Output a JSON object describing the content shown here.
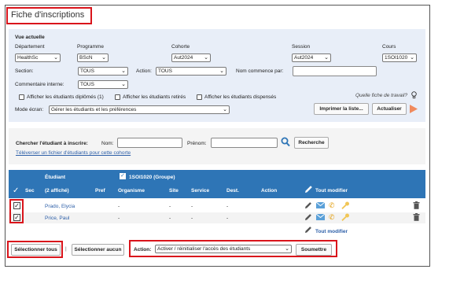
{
  "page_title": "Fiche d'inscriptions",
  "vue": {
    "heading": "Vue actuelle",
    "departement_label": "Département",
    "departement_value": "HealthSc",
    "programme_label": "Programme",
    "programme_value": "BScN",
    "cohorte_label": "Cohorte",
    "cohorte_value": "Aut2024",
    "session_label": "Session",
    "session_value": "Aut2024",
    "cours_label": "Cours",
    "cours_value": "1SOI1020",
    "section_label": "Section:",
    "section_value": "TOUS",
    "action_label": "Action:",
    "action_value": "TOUS",
    "nom_commence_label": "Nom commence par:",
    "commentaire_label": "Commentaire interne:",
    "commentaire_value": "TOUS",
    "cb_diplomes": "Afficher les étudiants diplômés (1)",
    "cb_retires": "Afficher les étudiants retirés",
    "cb_dispenses": "Afficher les étudiants dispensés",
    "quelle_fiche": "Quelle fiche de travail?",
    "mode_label": "Mode écran:",
    "mode_value": "Gérer les étudiants et les préférences",
    "imprimer_label": "Imprimer la liste...",
    "actualiser_label": "Actualiser"
  },
  "search": {
    "heading": "Chercher l'étudiant à inscrire:",
    "nom_label": "Nom:",
    "prenom_label": "Prénom:",
    "recherche_label": "Recherche",
    "upload_link": "Téléverser un fichier d'étudiants pour cette cohorte"
  },
  "table": {
    "etudiant_header": "Étudiant",
    "course_header": "1SOI1020",
    "course_group": "(Groupe)",
    "sec_header": "Sec",
    "count_header": "(2 affiché)",
    "pref_header": "Pref",
    "organisme_header": "Organisme",
    "site_header": "Site",
    "service_header": "Service",
    "dest_header": "Dest.",
    "action_header": "Action",
    "tout_modifier": "Tout modifier",
    "tout_modifier_bottom": "Tout modifier",
    "rows": [
      {
        "name": "Prado, Elycia",
        "organisme": "-",
        "site": "-",
        "service": "-",
        "dest": "-"
      },
      {
        "name": "Price, Paul",
        "organisme": "-",
        "site": "-",
        "service": "-",
        "dest": "-"
      }
    ]
  },
  "bottom": {
    "select_all": "Sélectionner tous",
    "separator": "|",
    "select_none": "Sélectionner aucun",
    "action_label": "Action:",
    "action_value": "Activer / réinitialiser l'accès des étudiants",
    "submit": "Soumettre"
  },
  "colors": {
    "highlight": "#d9141b",
    "header_blue": "#2e75b6",
    "link_blue": "#2d5fa8",
    "filter_bg": "#e8eef8",
    "play_orange": "#f08a5d",
    "mail_blue": "#5aa0d8",
    "phone_gold": "#e3a21a"
  }
}
